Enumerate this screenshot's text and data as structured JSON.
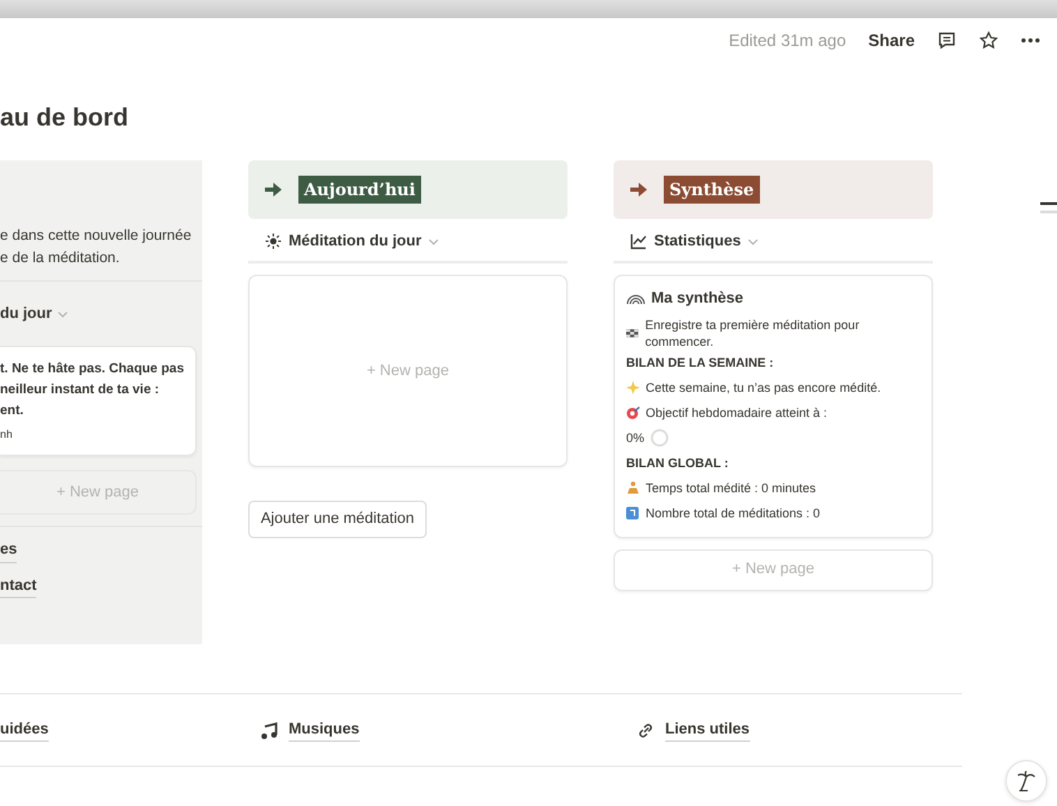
{
  "header": {
    "edited": "Edited 31m ago",
    "share": "Share"
  },
  "title": "au de bord",
  "left_column": {
    "intro_lines": [
      "e dans cette nouvelle journée",
      "e de la méditation."
    ],
    "view": "du jour",
    "quote_lines": [
      "t. Ne te hâte pas. Chaque pas",
      "neilleur instant de ta vie :",
      "ent."
    ],
    "quote_author": "nh",
    "new_page": "+ New page",
    "links": [
      "es",
      "ntact"
    ]
  },
  "columns": [
    {
      "kind": "empty",
      "heading": "Aujourd’hui",
      "color": "#3e5c44",
      "view": "Méditation du jour",
      "new_page": "+ New page",
      "button": "Ajouter une méditation"
    },
    {
      "kind": "summary",
      "heading": "Synthèse",
      "color": "#8c4b33",
      "view": "Statistiques",
      "card_title": "Ma synthèse",
      "lines": [
        {
          "kind": "text",
          "text": "Enregistre ta première méditation pour commencer."
        },
        {
          "kind": "heading",
          "text": "BILAN DE LA SEMAINE :"
        },
        {
          "kind": "text",
          "text": "Cette semaine, tu n’as pas encore médité."
        },
        {
          "kind": "text",
          "text": "Objectif hebdomadaire atteint à :"
        },
        {
          "kind": "progress",
          "text": "0%",
          "level": 0
        },
        {
          "kind": "heading",
          "text": "BILAN GLOBAL :"
        },
        {
          "kind": "text",
          "text": "Temps total médité : 0 minutes"
        },
        {
          "kind": "text",
          "text": "Nombre total de méditations : 0"
        }
      ],
      "new_page": "+ New page"
    }
  ],
  "bottom_links": [
    {
      "label": "uidées"
    },
    {
      "label": "Musiques"
    },
    {
      "label": "Liens utiles"
    }
  ]
}
